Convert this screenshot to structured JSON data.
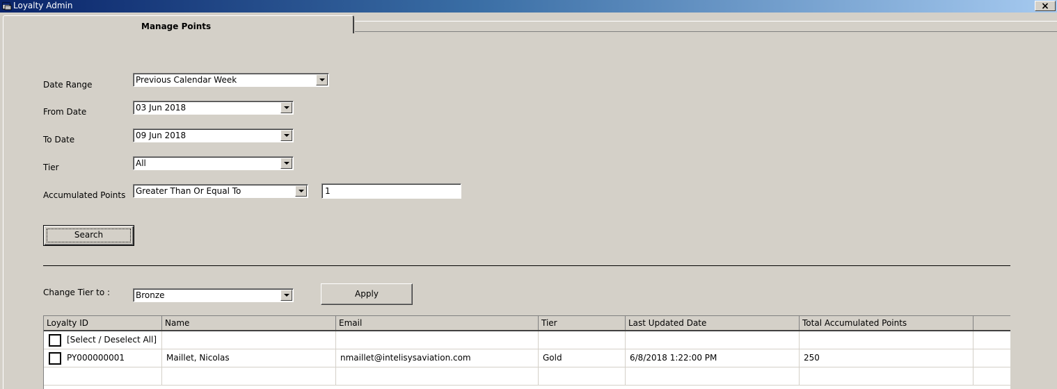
{
  "window": {
    "title": "Loyalty Admin",
    "close_label": "×"
  },
  "tabs": [
    {
      "label": "Manage Points",
      "active": true
    }
  ],
  "filters": {
    "date_range": {
      "label": "Date Range",
      "value": "Previous Calendar Week"
    },
    "from_date": {
      "label": "From Date",
      "value": "03 Jun 2018"
    },
    "to_date": {
      "label": "To Date",
      "value": "09 Jun 2018"
    },
    "tier": {
      "label": "Tier",
      "value": "All"
    },
    "accumulated_points": {
      "label": "Accumulated Points",
      "operator": "Greater Than Or Equal To",
      "value": "1"
    }
  },
  "search_button": "Search",
  "change_tier": {
    "label": "Change Tier to :",
    "value": "Bronze",
    "apply_label": "Apply"
  },
  "grid": {
    "columns": [
      "Loyalty ID",
      "Name",
      "Email",
      "Tier",
      "Last Updated Date",
      "Total Accumulated Points"
    ],
    "select_all_label": "[Select / Deselect All]",
    "rows": [
      {
        "loyalty_id": "PY000000001",
        "name": "Maillet, Nicolas",
        "email": "nmaillet@intelisysaviation.com",
        "tier": "Gold",
        "last_updated": "6/8/2018 1:22:00 PM",
        "total_points": "250",
        "checked": false
      }
    ]
  },
  "colors": {
    "face": "#d4d0c8",
    "title_start": "#0a246a",
    "title_end": "#a6caf0"
  },
  "icons": {
    "app": "window-app-icon",
    "dropdown": "chevron-down-icon"
  }
}
